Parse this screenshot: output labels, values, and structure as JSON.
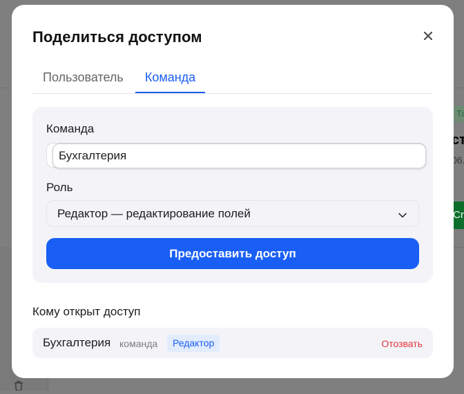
{
  "background": {
    "tag_text": "Та",
    "title_fragment": "ст",
    "subtitle_fragment": "06.",
    "button_fragment": "Cro"
  },
  "modal": {
    "title": "Поделиться доступом",
    "close_icon": "close-icon",
    "tabs": [
      {
        "label": "Пользователь",
        "active": false
      },
      {
        "label": "Команда",
        "active": true
      }
    ]
  },
  "form": {
    "team_label": "Команда",
    "team_value": "Бухгалтерия",
    "role_label": "Роль",
    "role_value": "Редактор — редактирование полей",
    "submit_label": "Предоставить доступ"
  },
  "access": {
    "heading": "Кому открыт доступ",
    "entries": [
      {
        "name": "Бухгалтерия",
        "type": "команда",
        "role": "Редактор",
        "action": "Отозвать"
      }
    ]
  },
  "colors": {
    "accent": "#1a5ff5",
    "danger": "#e4343b",
    "badge_bg": "#e3ecfd"
  }
}
